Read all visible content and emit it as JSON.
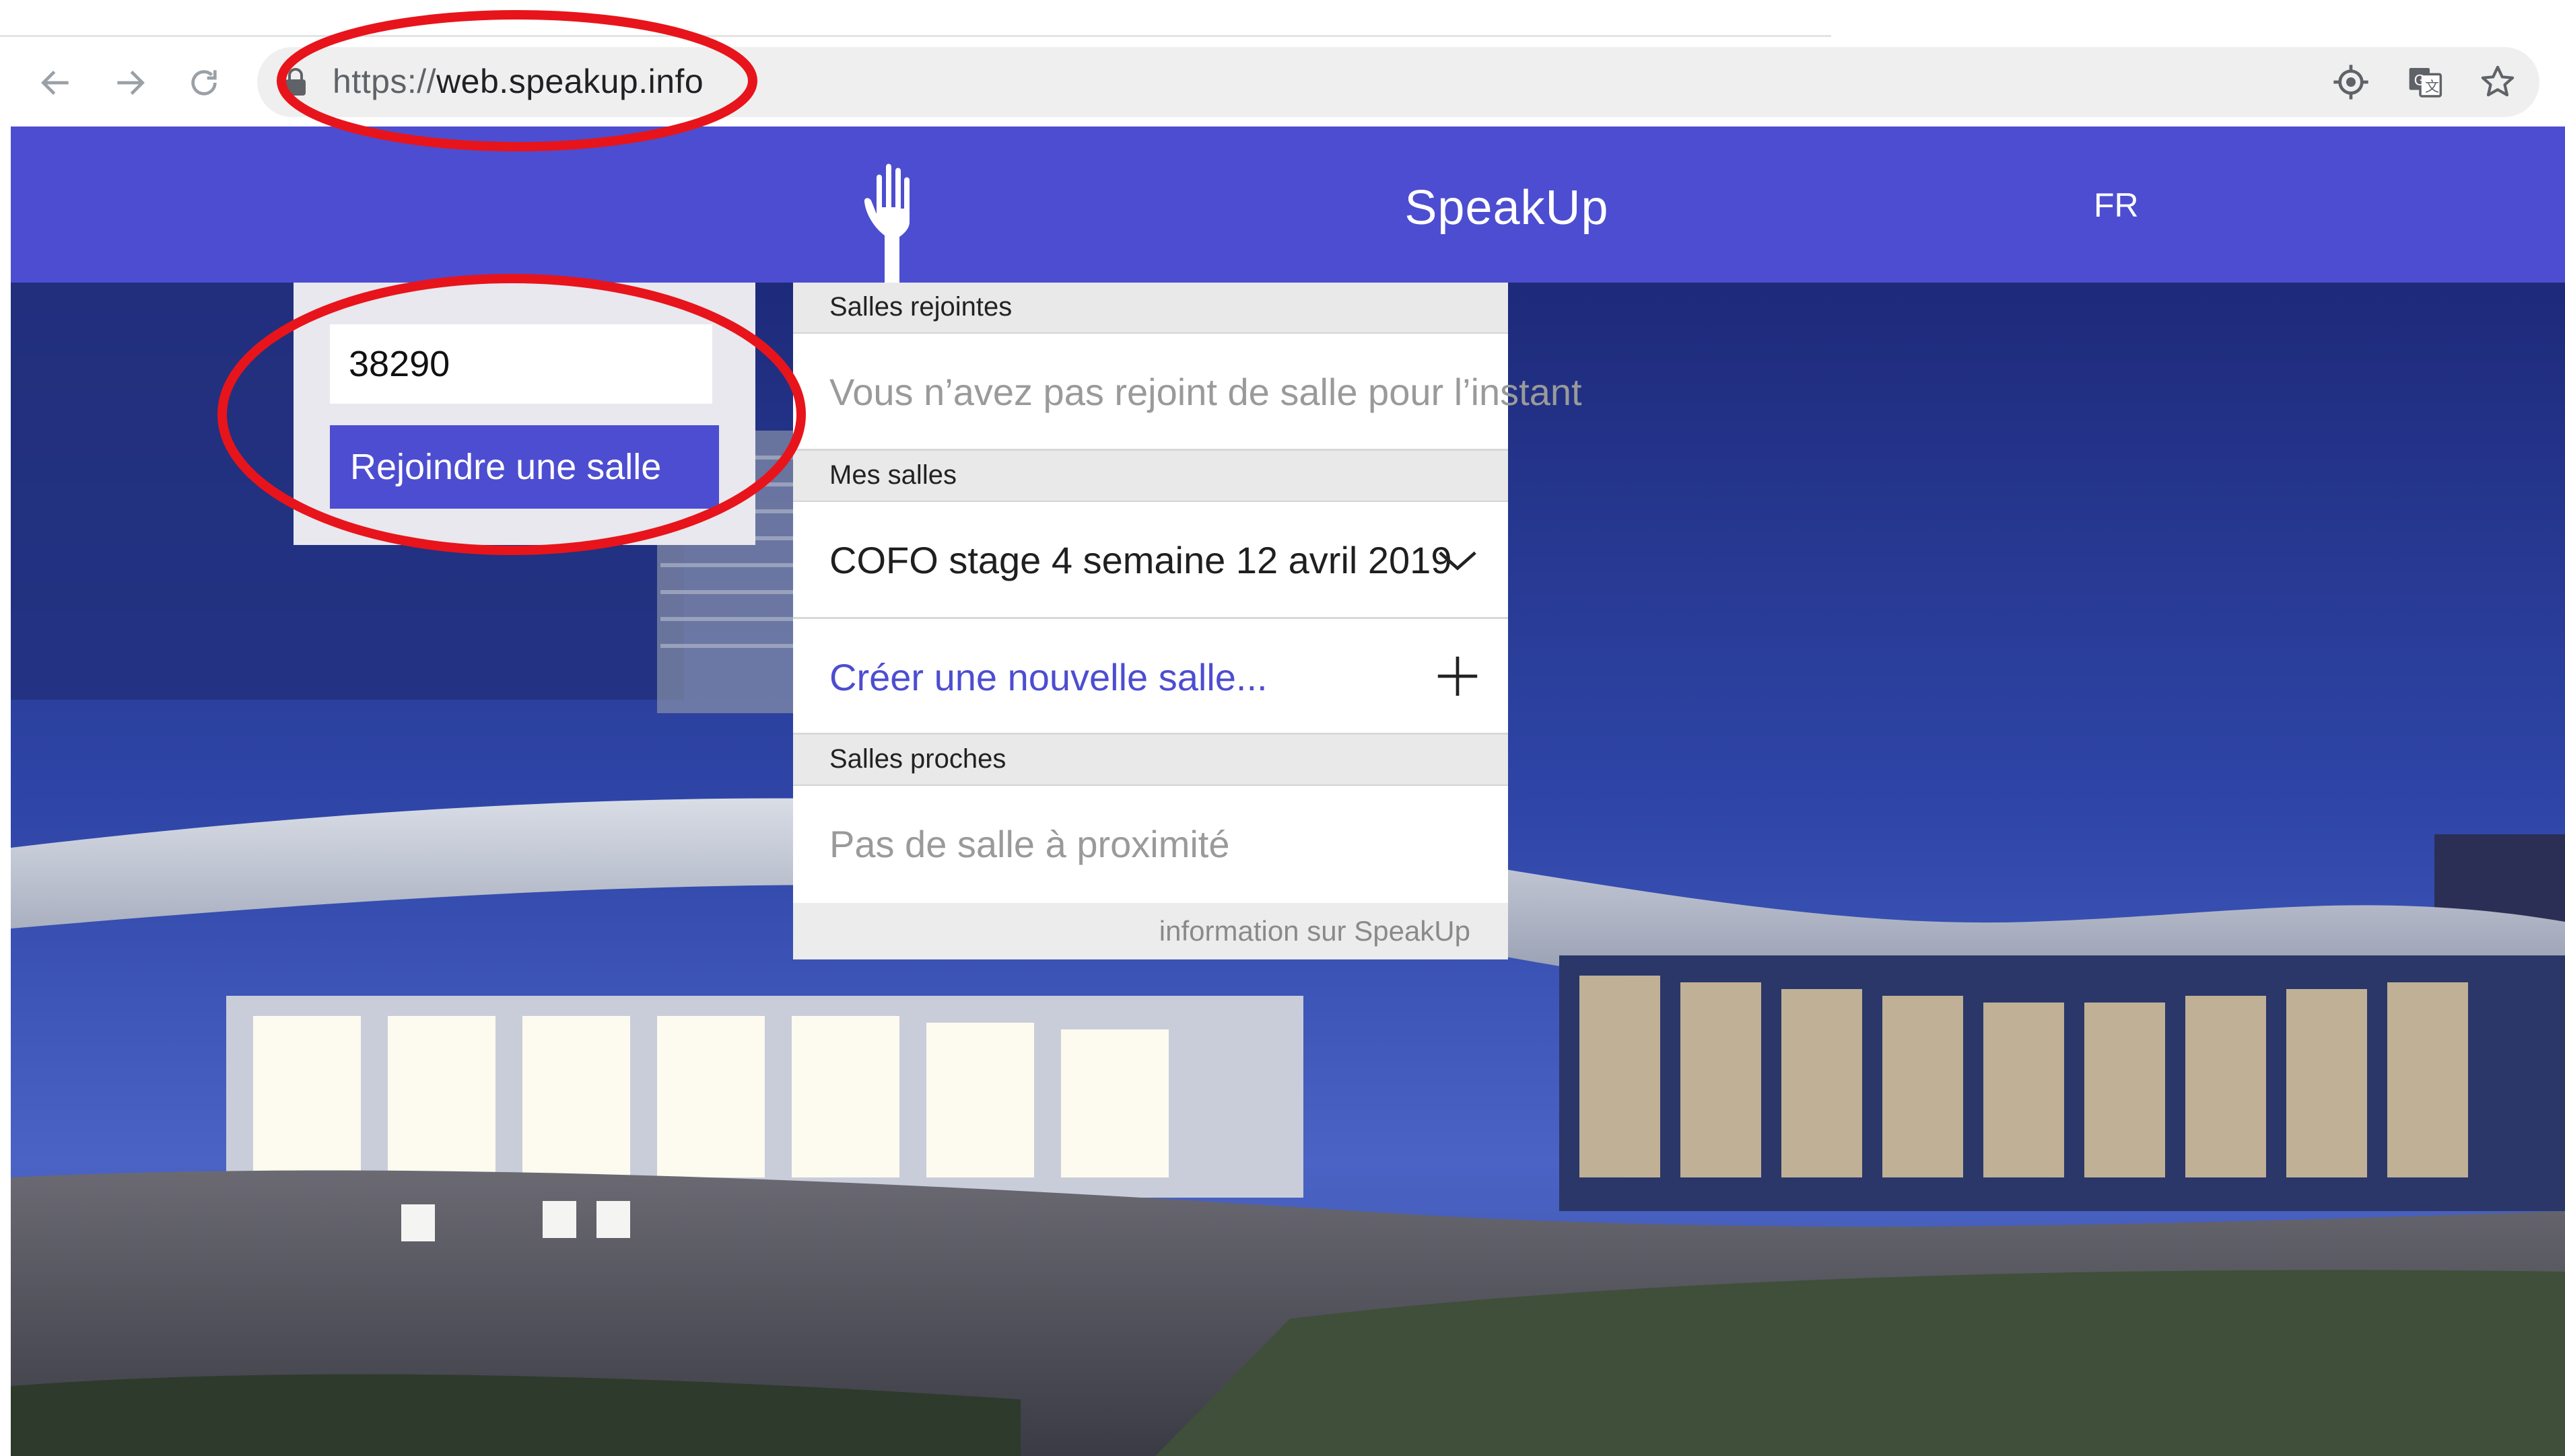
{
  "browser": {
    "url_scheme": "https://",
    "url_host": "web.speakup.info",
    "icons": [
      "back-arrow-icon",
      "forward-arrow-icon",
      "reload-icon",
      "lock-icon",
      "location-target-icon",
      "translate-icon",
      "bookmark-star-icon"
    ]
  },
  "header": {
    "title": "SpeakUp",
    "language": "FR",
    "logo": "raised-hand-icon",
    "color": "#4d4dd1"
  },
  "join": {
    "room_number": "38290",
    "button_label": "Rejoindre une salle"
  },
  "panel": {
    "joined": {
      "header": "Salles rejointes",
      "empty_text": "Vous n’avez pas rejoint de salle pour l’instant"
    },
    "mine": {
      "header": "Mes salles",
      "rooms": [
        "COFO stage 4 semaine 12 avril 2019"
      ],
      "create_label": "Créer une nouvelle salle..."
    },
    "nearby": {
      "header": "Salles proches",
      "empty_text": "Pas de salle à proximité"
    },
    "footer_link": "information sur SpeakUp"
  },
  "colors": {
    "accent": "#4d4dd1",
    "annotation": "#e8141b"
  }
}
